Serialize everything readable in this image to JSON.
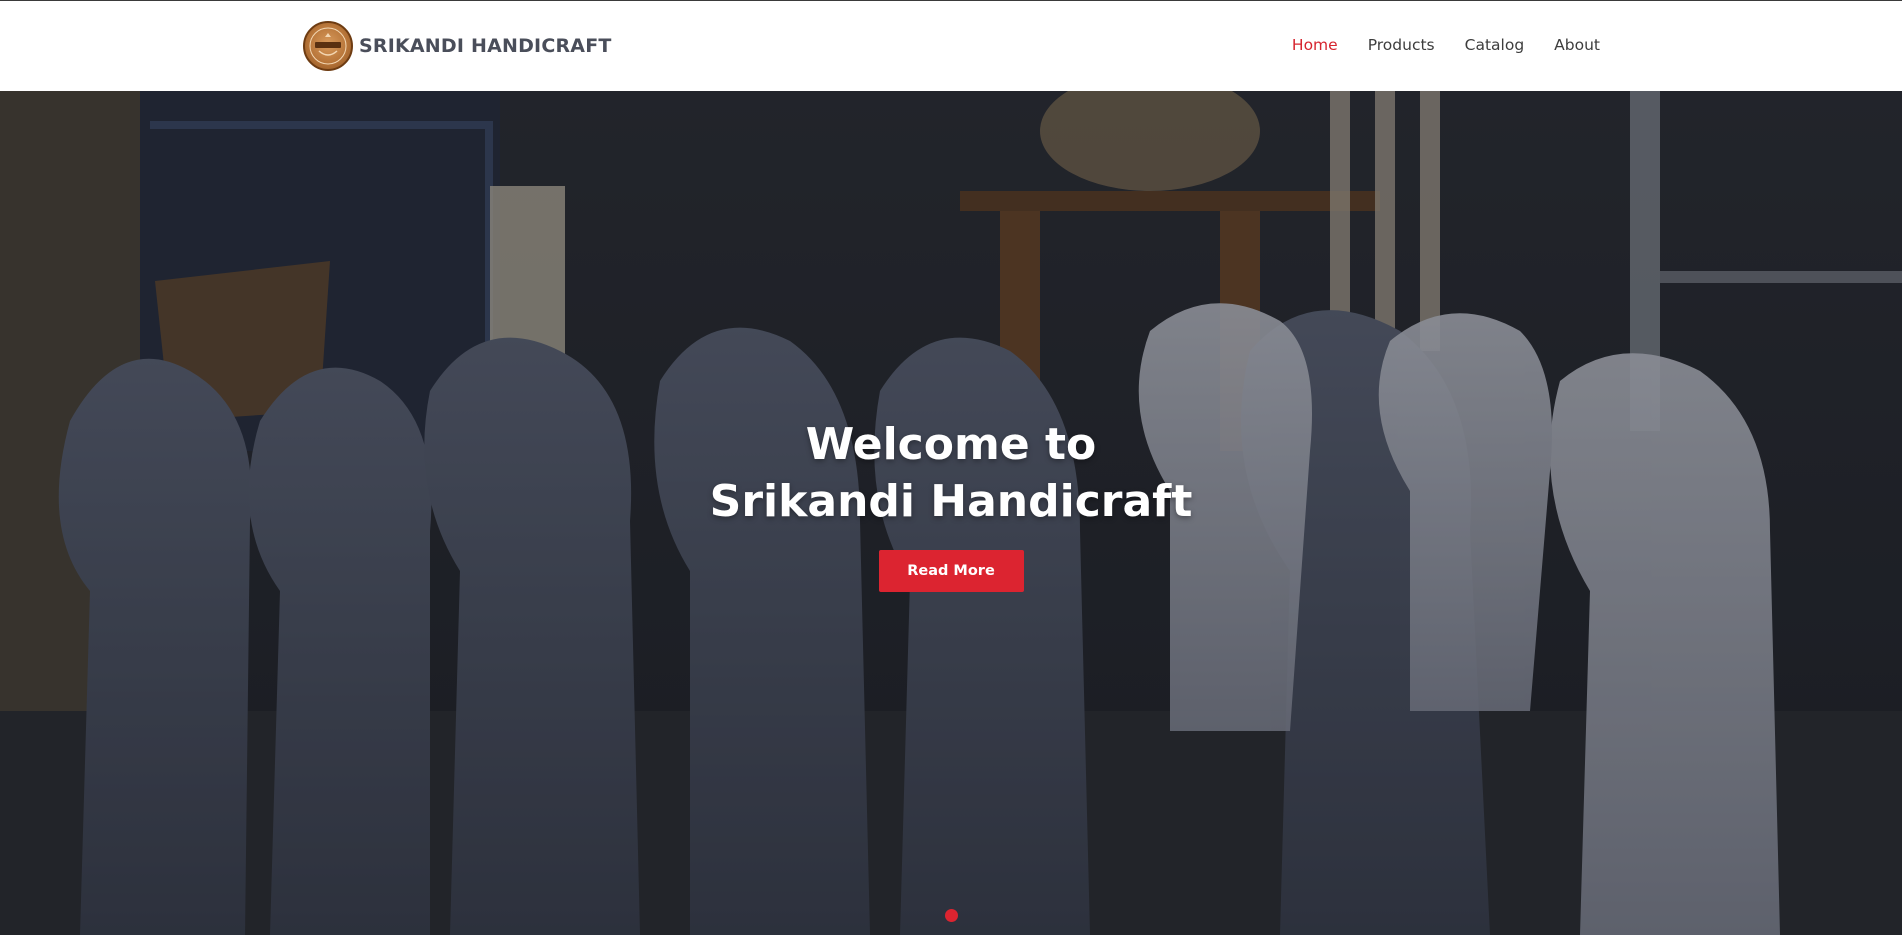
{
  "header": {
    "brand_name": "SRIKANDI HANDICRAFT",
    "logo_icon": "brand-logo-icon"
  },
  "nav": {
    "items": [
      {
        "label": "Home",
        "active": true
      },
      {
        "label": "Products",
        "active": false
      },
      {
        "label": "Catalog",
        "active": false
      },
      {
        "label": "About",
        "active": false
      }
    ]
  },
  "hero": {
    "title_line1": "Welcome to",
    "title_line2": "Srikandi Handicraft",
    "cta_label": "Read More",
    "slide_count": 1,
    "active_slide": 1
  },
  "colors": {
    "accent": "#dc2430",
    "nav_active": "#d6252f",
    "nav_text": "#3d3d3d",
    "brand_text": "#4a4e5a"
  }
}
